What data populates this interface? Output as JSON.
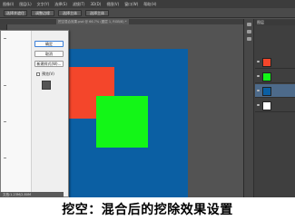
{
  "menu": {
    "items": [
      "图像(I)",
      "图层(L)",
      "文字(Y)",
      "选择(S)",
      "滤镜(T)",
      "3D(D)",
      "视图(V)",
      "窗口(W)",
      "帮助(H)"
    ]
  },
  "options_bar": {
    "buttons": [
      "选择并遮住",
      "调整边缘",
      "选择主体",
      "选择主体"
    ]
  },
  "document": {
    "tab_label": "挖空混合效果.psd @ 66.7% (图层 1, RGB/8) *"
  },
  "dialog": {
    "ok_label": "确定",
    "cancel_label": "取消",
    "new_style_label": "新建样式(W)...",
    "preview_label": "预览(V)",
    "preview_checked": true
  },
  "layers_panel": {
    "header": "图层"
  },
  "status_bar": {
    "text": "文档:1.23M/2.80M"
  },
  "caption": {
    "text": "挖空：混合后的挖除效果设置"
  },
  "colors": {
    "canvas_blue": "#0b5fa3",
    "red": "#f4462b",
    "green": "#13f617",
    "workspace": "#535353"
  }
}
